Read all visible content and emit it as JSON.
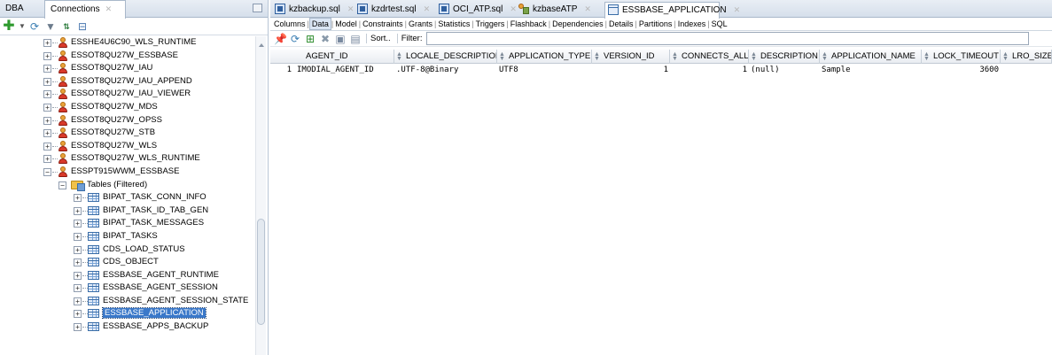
{
  "left_panel": {
    "tabs": [
      "DBA",
      "Connections"
    ],
    "tree": {
      "schemas": [
        "ESSHE4U6C90_WLS_RUNTIME",
        "ESSOT8QU27W_ESSBASE",
        "ESSOT8QU27W_IAU",
        "ESSOT8QU27W_IAU_APPEND",
        "ESSOT8QU27W_IAU_VIEWER",
        "ESSOT8QU27W_MDS",
        "ESSOT8QU27W_OPSS",
        "ESSOT8QU27W_STB",
        "ESSOT8QU27W_WLS",
        "ESSOT8QU27W_WLS_RUNTIME",
        "ESSPT915WWM_ESSBASE"
      ],
      "tables_folder": "Tables (Filtered)",
      "tables": [
        "BIPAT_TASK_CONN_INFO",
        "BIPAT_TASK_ID_TAB_GEN",
        "BIPAT_TASK_MESSAGES",
        "BIPAT_TASKS",
        "CDS_LOAD_STATUS",
        "CDS_OBJECT",
        "ESSBASE_AGENT_RUNTIME",
        "ESSBASE_AGENT_SESSION",
        "ESSBASE_AGENT_SESSION_STATE",
        "ESSBASE_APPLICATION",
        "ESSBASE_APPS_BACKUP"
      ],
      "selected_table": "ESSBASE_APPLICATION"
    }
  },
  "doc_tabs": [
    {
      "label": "kzbackup.sql",
      "icon": "sql-file-icon"
    },
    {
      "label": "kzdrtest.sql",
      "icon": "sql-file-icon"
    },
    {
      "label": "OCI_ATP.sql",
      "icon": "sql-file-icon"
    },
    {
      "label": "kzbaseATP",
      "icon": "connection-icon"
    },
    {
      "label": "ESSBASE_APPLICATION",
      "icon": "table-icon"
    }
  ],
  "sub_tabs": [
    "Columns",
    "Data",
    "Model",
    "Constraints",
    "Grants",
    "Statistics",
    "Triggers",
    "Flashback",
    "Dependencies",
    "Details",
    "Partitions",
    "Indexes",
    "SQL"
  ],
  "active_sub_tab": "Data",
  "grid_toolbar": {
    "sort_label": "Sort..",
    "filter_label": "Filter:",
    "filter_value": ""
  },
  "grid": {
    "columns": [
      "AGENT_ID",
      "LOCALE_DESCRIPTION",
      "APPLICATION_TYPE",
      "VERSION_ID",
      "CONNECTS_ALLOWED",
      "DESCRIPTION",
      "APPLICATION_NAME",
      "LOCK_TIMEOUT",
      "LRO_SIZE"
    ],
    "rows": [
      {
        "num": "1",
        "cells": [
          "IMODIAL_AGENT_ID",
          ".UTF-8@Binary",
          "UTF8",
          "1",
          "1",
          "(null)",
          "Sample",
          "3600",
          ""
        ]
      }
    ]
  }
}
